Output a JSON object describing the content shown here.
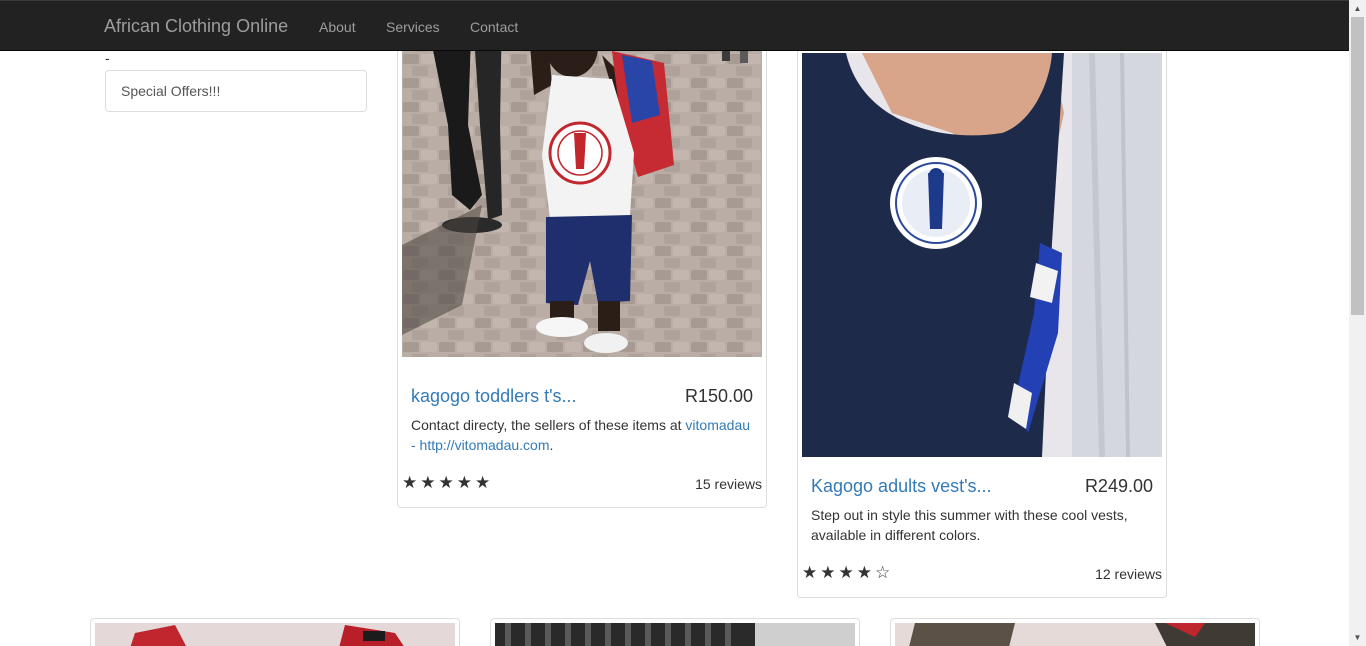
{
  "navbar": {
    "brand": "African Clothing Online",
    "links": [
      "About",
      "Services",
      "Contact"
    ]
  },
  "sidebar": {
    "dash": "-",
    "items": [
      "Special Offers!!!"
    ]
  },
  "products": [
    {
      "title": "kagogo toddlers t's...",
      "price": "R150.00",
      "description_prefix": "Contact directy, the sellers of these items at",
      "link_text": "vitomadau - http://vitomadau.com",
      "description_suffix": ".",
      "stars": "★★★★★",
      "rating": 5,
      "reviews": "15 reviews"
    },
    {
      "title": "Kagogo adults vest's...",
      "price": "R249.00",
      "description": "Step out in style this summer with these cool vests, available in different colors.",
      "stars": "★★★★☆",
      "rating": 4,
      "reviews": "12 reviews"
    }
  ],
  "colors": {
    "navbar_bg": "#222222",
    "link": "#337ab7",
    "border": "#dddddd"
  }
}
